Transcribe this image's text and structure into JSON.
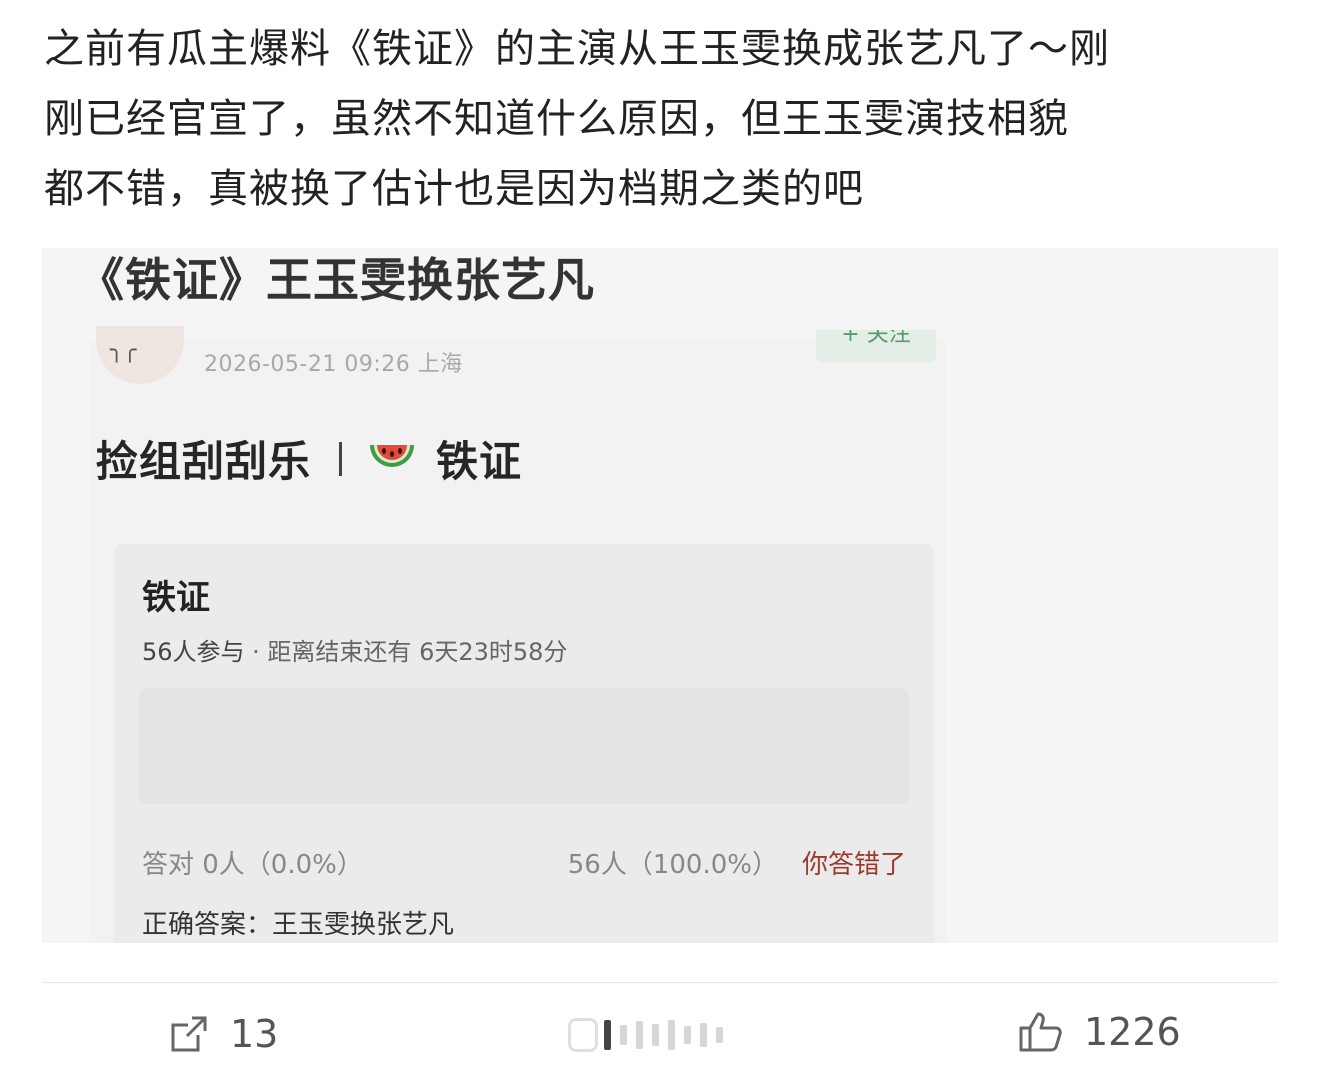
{
  "post": {
    "lines": [
      "之前有瓜主爆料《铁证》的主演从王玉雯换成张艺凡了～刚",
      "刚已经官宣了，虽然不知道什么原因，但王玉雯演技相貌",
      "都不错，真被换了估计也是因为档期之类的吧"
    ]
  },
  "embed": {
    "title": "《铁证》王玉雯换张艺凡",
    "meta": "2026-05-21 09:26  上海",
    "follow_label": "+ 关注",
    "heading_left": "捡组刮刮乐",
    "heading_right": "铁证",
    "quiz": {
      "title": "铁证",
      "participants": "56人参与",
      "dot": " · ",
      "countdown": "距离结束还有 6天23时58分",
      "correct_stat": "答对  0人（0.0%）",
      "wrong_stat": "56人（100.0%）",
      "wrong_label": "你答错了",
      "correct_answer": "正确答案：王玉雯换张艺凡"
    }
  },
  "actions": {
    "share_count": "13",
    "like_count": "1226"
  },
  "colors": {
    "follow": "#5a9a68",
    "wrong": "#9c3b2b"
  },
  "icons": [
    "share-icon",
    "comment-icon",
    "like-icon",
    "watermelon-icon"
  ]
}
